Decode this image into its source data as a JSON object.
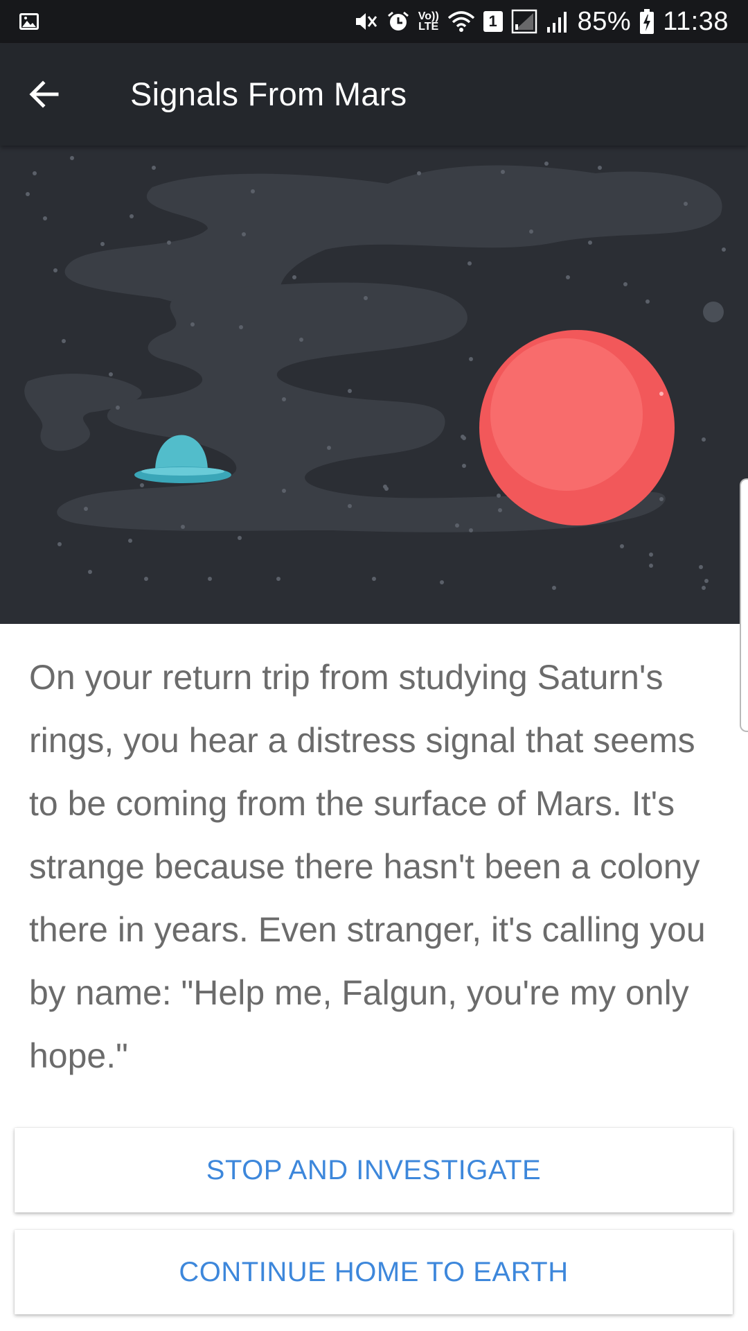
{
  "status_bar": {
    "battery_percent": "85%",
    "time": "11:38",
    "sim_slot": "1",
    "volte_label_top": "Vo))",
    "volte_label_bottom": "LTE"
  },
  "app_bar": {
    "title": "Signals From Mars"
  },
  "story": {
    "text": "On your return trip from studying Saturn's rings, you hear a distress signal that seems to be coming from the surface of Mars. It's strange because there hasn't been a colony there in years. Even stranger, it's calling you by name: \"Help me, Falgun, you're my only hope.\""
  },
  "choices": [
    {
      "label": "STOP AND INVESTIGATE"
    },
    {
      "label": "CONTINUE HOME TO EARTH"
    }
  ],
  "colors": {
    "status_bar_bg": "#17181b",
    "app_bar_bg": "#24272c",
    "hero_bg": "#2b2e34",
    "planet": "#f2585a",
    "ufo": "#4fbccb",
    "story_text": "#6b6b6b",
    "choice_text": "#3d87db"
  }
}
